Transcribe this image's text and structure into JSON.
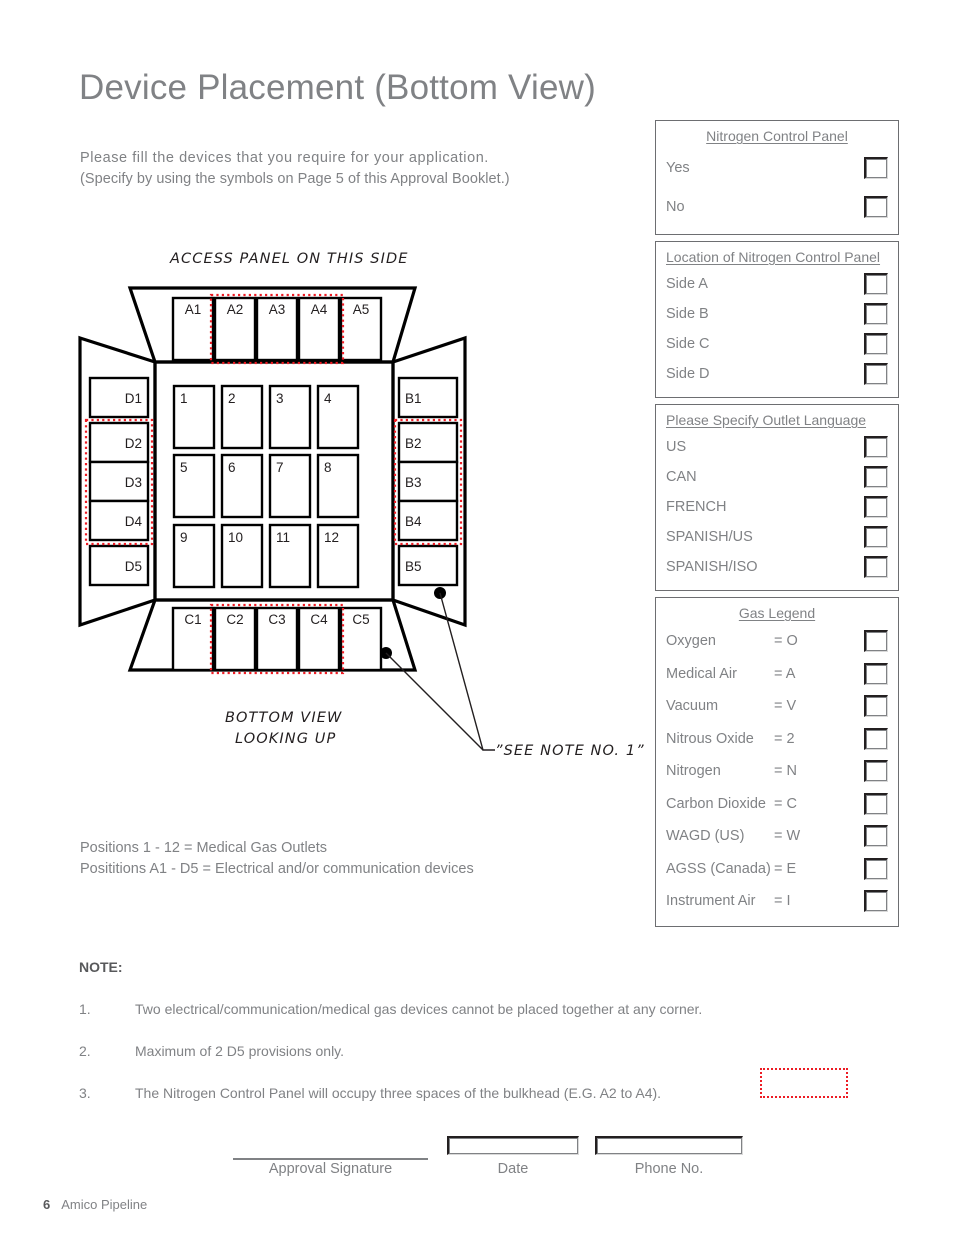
{
  "page": {
    "title": "Device Placement (Bottom View)",
    "intro_line1": "Please fill the devices that you  require for your application.",
    "intro_line2": "(Specify by using the symbols on Page 5 of this Approval Booklet.)"
  },
  "panels": {
    "nitrogen": {
      "title": "Nitrogen Control Panel",
      "options": [
        {
          "label": "Yes"
        },
        {
          "label": "No"
        }
      ]
    },
    "location": {
      "title": "Location of Nitrogen Control Panel",
      "options": [
        {
          "label": "Side A"
        },
        {
          "label": "Side B"
        },
        {
          "label": "Side C"
        },
        {
          "label": "Side D"
        }
      ]
    },
    "language": {
      "title": "Please Specify Outlet Language",
      "options": [
        {
          "label": "US"
        },
        {
          "label": "CAN"
        },
        {
          "label": "FRENCH"
        },
        {
          "label": "SPANISH/US"
        },
        {
          "label": "SPANISH/ISO"
        }
      ]
    },
    "gas_legend": {
      "title": "Gas Legend",
      "options": [
        {
          "label": "Oxygen",
          "symbol": "= O"
        },
        {
          "label": "Medical Air",
          "symbol": "= A"
        },
        {
          "label": "Vacuum",
          "symbol": "= V"
        },
        {
          "label": "Nitrous Oxide",
          "symbol": "= 2"
        },
        {
          "label": "Nitrogen",
          "symbol": "= N"
        },
        {
          "label": "Carbon Dioxide",
          "symbol": "= C"
        },
        {
          "label": "WAGD (US)",
          "symbol": "= W"
        },
        {
          "label": "AGSS (Canada)",
          "symbol": "= E"
        },
        {
          "label": "Instrument Air",
          "symbol": "= I"
        }
      ]
    }
  },
  "diagram": {
    "access_panel_label": "ACCESS  PANEL  ON  THIS  SIDE",
    "bottom_view_line1": "BOTTOM  VIEW",
    "bottom_view_line2": "LOOKING  UP",
    "see_note_label": "”SEE  NOTE  NO.  1”",
    "side_a": [
      "A1",
      "A2",
      "A3",
      "A4",
      "A5"
    ],
    "side_b": [
      "B1",
      "B2",
      "B3",
      "B4",
      "B5"
    ],
    "side_c": [
      "C1",
      "C2",
      "C3",
      "C4",
      "C5"
    ],
    "side_d": [
      "D1",
      "D2",
      "D3",
      "D4",
      "D5"
    ],
    "outlets": [
      "1",
      "2",
      "3",
      "4",
      "5",
      "6",
      "7",
      "8",
      "9",
      "10",
      "11",
      "12"
    ],
    "highlight_color": "#ed1c24",
    "highlighted_a": [
      "A2",
      "A3",
      "A4"
    ],
    "highlighted_b": [
      "B2",
      "B3",
      "B4"
    ],
    "highlighted_c": [
      "C2",
      "C3",
      "C4"
    ],
    "highlighted_d": [
      "D2",
      "D3",
      "D4"
    ]
  },
  "positions": {
    "line1": "Positions 1 - 12 = Medical Gas Outlets",
    "line2": "Posititions A1 - D5 = Electrical and/or communication devices"
  },
  "notes": {
    "heading": "NOTE:",
    "items": [
      {
        "num": "1.",
        "text": "Two electrical/communication/medical gas devices cannot be placed together at any corner."
      },
      {
        "num": "2.",
        "text": "Maximum of 2 D5 provisions only."
      },
      {
        "num": "3.",
        "text": "The Nitrogen Control Panel will occupy three spaces of the bulkhead (E.G. A2 to A4)."
      }
    ]
  },
  "signature": {
    "approval_label": "Approval Signature",
    "date_label": "Date",
    "phone_label": "Phone No.",
    "approval_value": "",
    "date_value": "",
    "phone_value": ""
  },
  "footer": {
    "page_number": "6",
    "company": "Amico Pipeline"
  }
}
